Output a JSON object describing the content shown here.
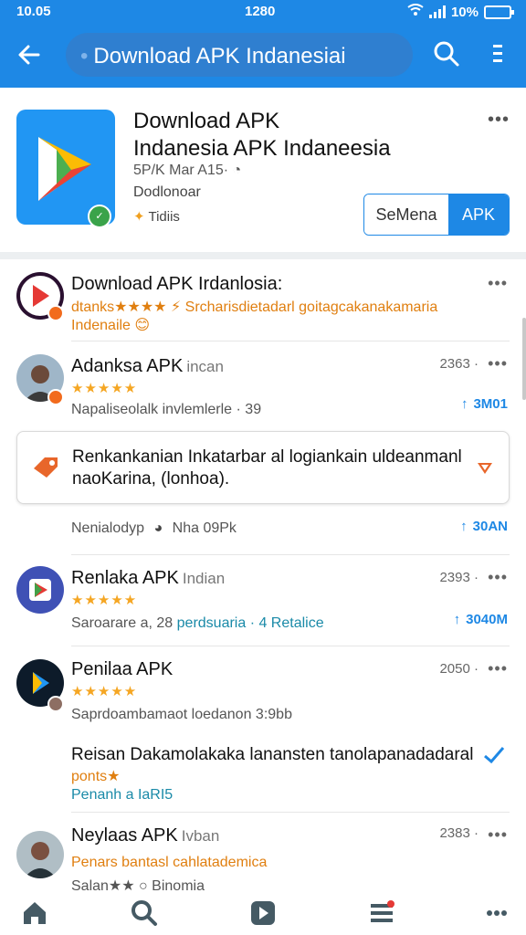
{
  "status_bar": {
    "time": "10.05",
    "center": "1280",
    "battery": "10%"
  },
  "search": {
    "query": "Download APK Indanesiai"
  },
  "featured": {
    "title_line1": "Download APK",
    "title_line2": "Indanesia APK Indaneesia",
    "meta": "5P/K Mar A15·",
    "developer": "Dodlonoar",
    "tag": "Tidiis",
    "more": "•••",
    "seg_left": "SeMena",
    "seg_right": "APK"
  },
  "list": [
    {
      "title": "Download APK Irdanlosia:",
      "orange": "dtanks★★★★ ⚡ Srcharisdietadarl goitagcakanakamaria",
      "orange2": "Indenaile 😊",
      "more": "•••"
    },
    {
      "title": "Adanksa APK",
      "sub": "incan",
      "stars": "★★★★★",
      "text": "Napaliseolalk invlemlerle · 39",
      "count": "2363 ·",
      "more": "•••",
      "downloads": "3M01"
    },
    {
      "text": "Nenialodyp",
      "text_b": "Nha 09Pk",
      "downloads": "30AN"
    },
    {
      "title": "Renlaka APK",
      "sub": "Indian",
      "stars": "★★★★★",
      "text": "Saroarare a, 28",
      "teal": "perdsuaria · 4 Retalice",
      "count": "2393 ·",
      "more": "•••",
      "downloads": "3040M"
    },
    {
      "title": "Penilaa APK",
      "stars": "★★★★★",
      "text": "Saprdoambamaot loedanon 3:9bb",
      "count": "2050 ·",
      "more": "•••"
    },
    {
      "title": "Reisan Dakamolakaka lanansten tanolapanadadaral",
      "orange": "ponts★",
      "teal": "Penanh a IaRI5"
    },
    {
      "title": "Neylaas APK",
      "sub": "Ivban",
      "orange": "Penars bantasl cahlatademica",
      "text": "Salan★★ ○ Binomia",
      "count": "2383 ·",
      "more": "•••"
    }
  ],
  "card": {
    "line1": "Renkankanian Inkatarbar al logiankain uldeanmanl",
    "line2": "naoKarina, (lonhoa)."
  },
  "colors": {
    "primary": "#1e88e5",
    "star": "#f5a623",
    "teal": "#1a8aa8",
    "orange": "#e07f10"
  },
  "icons": [
    "back-arrow-icon",
    "search-icon",
    "overflow-menu-icon",
    "home-icon",
    "search-icon",
    "apps-icon",
    "list-icon",
    "more-icon"
  ]
}
